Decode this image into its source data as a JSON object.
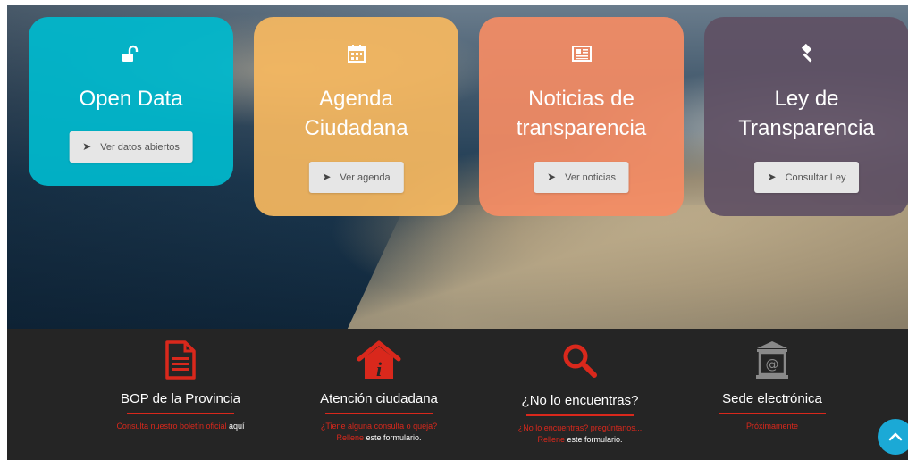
{
  "cards": [
    {
      "title": "Open Data",
      "button": "Ver datos abiertos",
      "icon": "unlock-icon"
    },
    {
      "title_line1": "Agenda",
      "title_line2": "Ciudadana",
      "button": "Ver agenda",
      "icon": "calendar-icon"
    },
    {
      "title_line1": "Noticias de",
      "title_line2": "transparencia",
      "button": "Ver noticias",
      "icon": "newspaper-icon"
    },
    {
      "title_line1": "Ley de",
      "title_line2": "Transparencia",
      "button": "Consultar Ley",
      "icon": "gavel-icon"
    }
  ],
  "features": [
    {
      "title": "BOP de la Provincia",
      "desc_red": "Consulta nuestro boletín oficial",
      "desc_white": "aquí",
      "icon": "document-icon"
    },
    {
      "title": "Atención ciudadana",
      "desc_red": "¿Tiene alguna consulta o queja?",
      "desc_red2": "Rellene",
      "desc_white": "este formulario",
      "desc_tail": ".",
      "icon": "house-info-icon"
    },
    {
      "title": "¿No lo encuentras?",
      "desc_red": "¿No lo encuentras? pregúntanos...",
      "desc_red2": "Rellene",
      "desc_white": "este formulario",
      "desc_tail": ".",
      "icon": "search-icon"
    },
    {
      "title": "Sede electrónica",
      "desc_red": "Próximamente",
      "icon": "institution-icon"
    }
  ],
  "colors": {
    "open_data": "#00b9cd",
    "agenda": "#f7b95f",
    "noticias": "#f58c64",
    "ley": "#605064",
    "accent_red": "#d9281c",
    "dark_bg": "#252525",
    "fab": "#1ba9d6"
  },
  "fab": {
    "icon": "chevron-up-icon"
  }
}
